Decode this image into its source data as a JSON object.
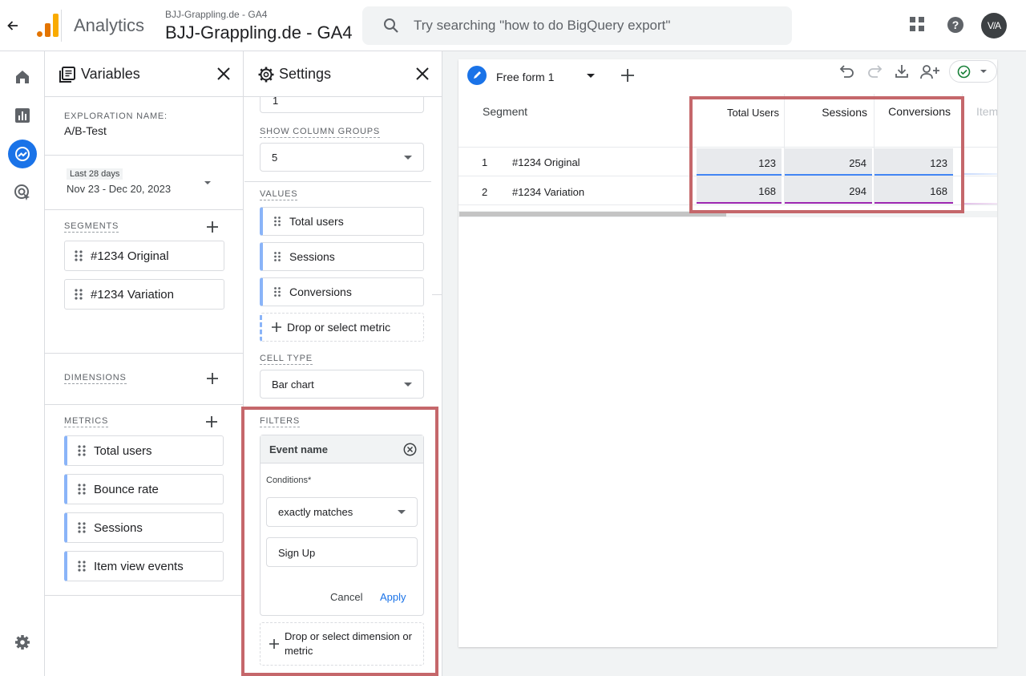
{
  "header": {
    "product_name": "Analytics",
    "account_breadcrumb": "BJJ-Grappling.de - GA4",
    "property_name": "BJJ-Grappling.de - GA4",
    "search_placeholder": "Try searching \"how to do BigQuery export\"",
    "avatar_text": "V/A"
  },
  "variables": {
    "title": "Variables",
    "exploration_name_label": "EXPLORATION NAME:",
    "exploration_name": "A/B-Test",
    "date_range_label": "Last 28 days",
    "date_range": "Nov 23 - Dec 20, 2023",
    "segments_label": "SEGMENTS",
    "segments": [
      "#1234 Original",
      "#1234 Variation"
    ],
    "dimensions_label": "DIMENSIONS",
    "metrics_label": "METRICS",
    "metrics": [
      "Total users",
      "Bounce rate",
      "Sessions",
      "Item view events"
    ]
  },
  "settings": {
    "title": "Settings",
    "top_field_value": "1",
    "show_column_groups_label": "SHOW COLUMN GROUPS",
    "show_column_groups_value": "5",
    "values_label": "VALUES",
    "values": [
      "Total users",
      "Sessions",
      "Conversions"
    ],
    "drop_metric_label": "Drop or select metric",
    "cell_type_label": "CELL TYPE",
    "cell_type_value": "Bar chart",
    "filters_label": "FILTERS",
    "filter": {
      "name": "Event name",
      "conditions_label": "Conditions*",
      "condition": "exactly matches",
      "value": "Sign Up",
      "cancel_label": "Cancel",
      "apply_label": "Apply"
    },
    "drop_dimension_label": "Drop or select dimension or metric"
  },
  "canvas": {
    "tab_label": "Free form 1",
    "table": {
      "segment_header": "Segment",
      "columns": [
        "Total Users",
        "Sessions",
        "Conversions",
        "Item"
      ],
      "rows": [
        {
          "index": "1",
          "segment": "#1234 Original",
          "values": [
            "123",
            "254",
            "123"
          ]
        },
        {
          "index": "2",
          "segment": "#1234 Variation",
          "values": [
            "168",
            "294",
            "168"
          ]
        }
      ]
    }
  },
  "colors": {
    "accent": "#1a73e8",
    "highlight": "#c5676b",
    "row1_bar": "#4285f4",
    "row2_bar": "#9c27b0",
    "success": "#188038"
  }
}
